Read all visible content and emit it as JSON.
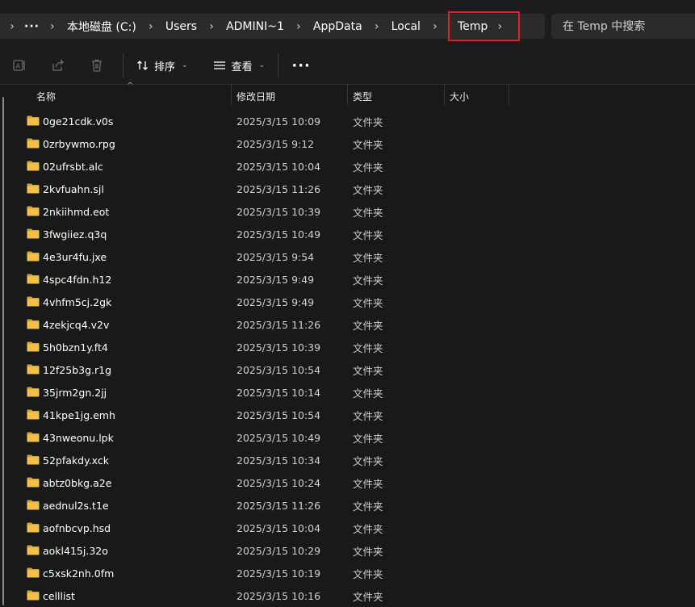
{
  "breadcrumb": {
    "ellipsis": "···",
    "items": [
      "本地磁盘 (C:)",
      "Users",
      "ADMINI~1",
      "AppData",
      "Local"
    ],
    "active": "Temp"
  },
  "search": {
    "placeholder": "在 Temp 中搜索"
  },
  "toolbar": {
    "icons": [
      "ai-rename-icon",
      "share-icon",
      "delete-icon"
    ],
    "sort_label": "排序",
    "view_label": "查看",
    "more_label": "···"
  },
  "columns": {
    "name": "名称",
    "date": "修改日期",
    "type": "类型",
    "size": "大小"
  },
  "files": [
    {
      "name": "0ge21cdk.v0s",
      "date": "2025/3/15 10:09",
      "type": "文件夹"
    },
    {
      "name": "0zrbywmo.rpg",
      "date": "2025/3/15 9:12",
      "type": "文件夹"
    },
    {
      "name": "02ufrsbt.alc",
      "date": "2025/3/15 10:04",
      "type": "文件夹"
    },
    {
      "name": "2kvfuahn.sjl",
      "date": "2025/3/15 11:26",
      "type": "文件夹"
    },
    {
      "name": "2nkiihmd.eot",
      "date": "2025/3/15 10:39",
      "type": "文件夹"
    },
    {
      "name": "3fwgiiez.q3q",
      "date": "2025/3/15 10:49",
      "type": "文件夹"
    },
    {
      "name": "4e3ur4fu.jxe",
      "date": "2025/3/15 9:54",
      "type": "文件夹"
    },
    {
      "name": "4spc4fdn.h12",
      "date": "2025/3/15 9:49",
      "type": "文件夹"
    },
    {
      "name": "4vhfm5cj.2gk",
      "date": "2025/3/15 9:49",
      "type": "文件夹"
    },
    {
      "name": "4zekjcq4.v2v",
      "date": "2025/3/15 11:26",
      "type": "文件夹"
    },
    {
      "name": "5h0bzn1y.ft4",
      "date": "2025/3/15 10:39",
      "type": "文件夹"
    },
    {
      "name": "12f25b3g.r1g",
      "date": "2025/3/15 10:54",
      "type": "文件夹"
    },
    {
      "name": "35jrm2gn.2jj",
      "date": "2025/3/15 10:14",
      "type": "文件夹"
    },
    {
      "name": "41kpe1jg.emh",
      "date": "2025/3/15 10:54",
      "type": "文件夹"
    },
    {
      "name": "43nweonu.lpk",
      "date": "2025/3/15 10:49",
      "type": "文件夹"
    },
    {
      "name": "52pfakdy.xck",
      "date": "2025/3/15 10:34",
      "type": "文件夹"
    },
    {
      "name": "abtz0bkg.a2e",
      "date": "2025/3/15 10:24",
      "type": "文件夹"
    },
    {
      "name": "aednul2s.t1e",
      "date": "2025/3/15 11:26",
      "type": "文件夹"
    },
    {
      "name": "aofnbcvp.hsd",
      "date": "2025/3/15 10:04",
      "type": "文件夹"
    },
    {
      "name": "aokl415j.32o",
      "date": "2025/3/15 10:29",
      "type": "文件夹"
    },
    {
      "name": "c5xsk2nh.0fm",
      "date": "2025/3/15 10:19",
      "type": "文件夹"
    },
    {
      "name": "celllist",
      "date": "2025/3/15 10:16",
      "type": "文件夹"
    }
  ],
  "colors": {
    "folder": "#f5c045",
    "folder_dark": "#d9a12b",
    "highlight_border": "#e0202a"
  }
}
